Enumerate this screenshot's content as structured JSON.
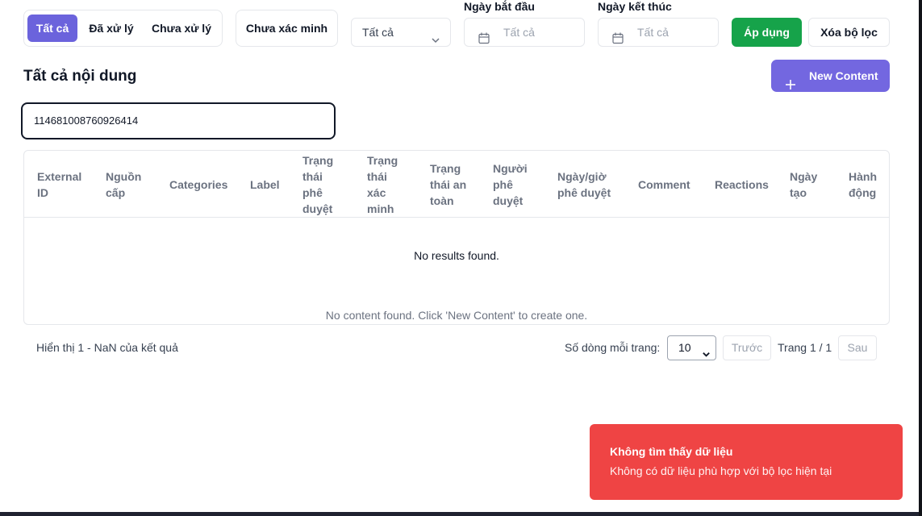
{
  "filters": {
    "status_tabs": [
      {
        "label": "Tất cả",
        "active": true
      },
      {
        "label": "Đã xử lý",
        "active": false
      },
      {
        "label": "Chưa xử lý",
        "active": false
      }
    ],
    "unverified_label": "Chưa xác minh",
    "type_select_value": "Tất cả",
    "start_date_label": "Ngày bắt đầu",
    "start_date_placeholder": "Tất cả",
    "end_date_label": "Ngày kết thúc",
    "end_date_placeholder": "Tất cả",
    "apply_label": "Áp dụng",
    "clear_label": "Xóa bộ lọc"
  },
  "header": {
    "title": "Tất cả nội dung",
    "new_button_label": "New Content"
  },
  "search": {
    "value": "114681008760926414"
  },
  "table": {
    "columns": [
      "External ID",
      "Nguồn cấp",
      "Categories",
      "Label",
      "Trạng thái phê duyệt",
      "Trạng thái xác minh",
      "Trạng thái an toàn",
      "Người phê duyệt",
      "Ngày/giờ phê duyệt",
      "Comment",
      "Reactions",
      "Ngày tạo",
      "Hành động"
    ],
    "no_results": "No results found.",
    "empty_hint": "No content found. Click 'New Content' to create one."
  },
  "pagination": {
    "summary": "Hiển thị 1 - NaN của kết quả",
    "rows_per_page_label": "Số dòng mỗi trang:",
    "rows_per_page_value": "10",
    "prev_label": "Trước",
    "page_info": "Trang 1 / 1",
    "next_label": "Sau"
  },
  "toast": {
    "title": "Không tìm thấy dữ liệu",
    "body": "Không có dữ liệu phù hợp với bộ lọc hiện tại"
  },
  "colors": {
    "primary": "#6b63dc",
    "success": "#16a34a",
    "danger": "#ef4444"
  }
}
